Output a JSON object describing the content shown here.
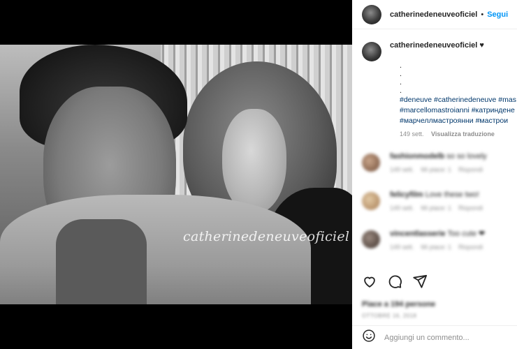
{
  "header": {
    "username": "catherinedeneuveoficiel",
    "separator": "•",
    "follow_label": "Segui"
  },
  "media": {
    "watermark": "catherinedeneuveoficiel"
  },
  "caption": {
    "username": "catherinedeneuveoficiel",
    "emoji": "♥",
    "dots": [
      ".",
      ".",
      ".",
      "."
    ],
    "hashtag_lines": [
      "#deneuve #catherinedeneuve #mas",
      "#marcellomastroianni #катриндене",
      "#марчеллмастроянни #мастрои"
    ],
    "time": "149 sett.",
    "translate_label": "Visualizza traduzione"
  },
  "comments": [
    {
      "user": "fashionmodelb",
      "text": "so so lovely",
      "time": "149 sett.",
      "likes": "Mi piace: 1",
      "reply": "Rispondi"
    },
    {
      "user": "felicyfilm",
      "text": "Love these two!",
      "time": "149 sett.",
      "likes": "Mi piace: 1",
      "reply": "Rispondi"
    },
    {
      "user": "vincentlasserie",
      "text": "Too cute ❤",
      "time": "149 sett.",
      "likes": "Mi piace: 1",
      "reply": "Rispondi"
    }
  ],
  "likes_text": "Piace a 194 persone",
  "date_text": "OTTOBRE 16, 2018",
  "add_comment": {
    "placeholder": "Aggiungi un commento..."
  },
  "icons": {
    "like": "heart-icon",
    "comment": "comment-icon",
    "share": "share-icon",
    "emoji": "emoji-icon"
  },
  "colors": {
    "link": "#00376b",
    "follow": "#0095f6",
    "text": "#262626",
    "muted": "#8e8e8e"
  }
}
